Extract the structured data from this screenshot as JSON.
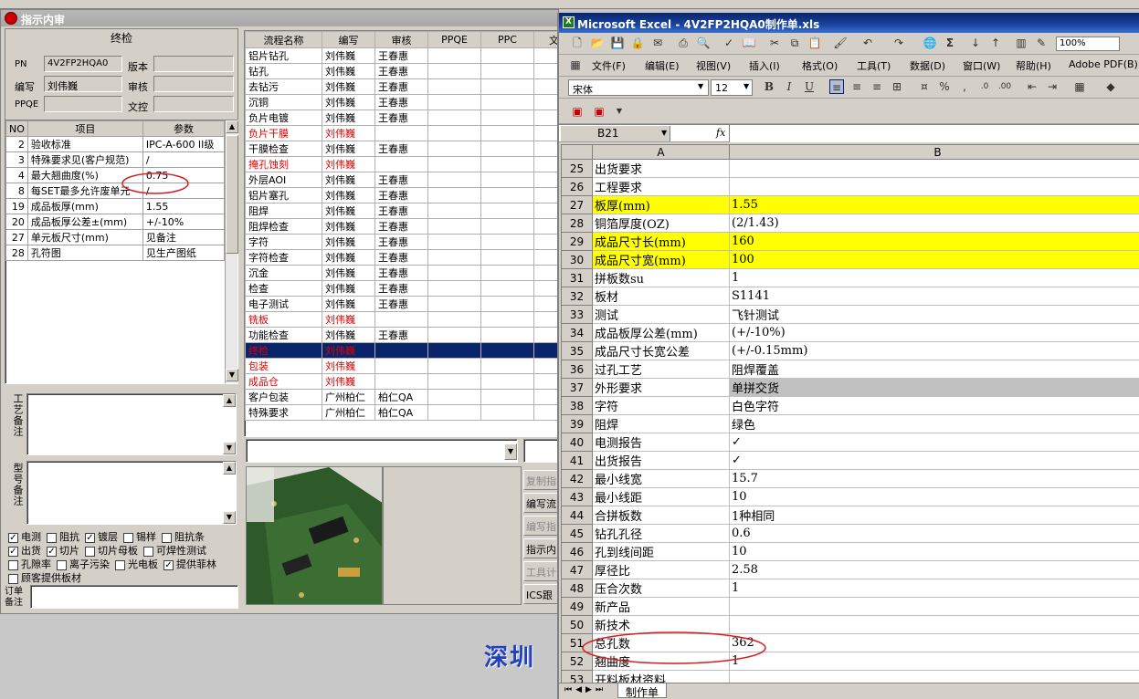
{
  "left_window": {
    "title": "指示内审",
    "section_title": "终检",
    "fields": {
      "pn_label": "PN",
      "pn_value": "4V2FP2HQA0",
      "version_label": "版本",
      "editor_label": "编写",
      "editor_value": "刘伟巍",
      "audit_label": "审核",
      "ppqe_label": "PPQE",
      "control_label": "文控"
    },
    "param_table": {
      "headers": [
        "NO",
        "项目",
        "参数"
      ],
      "rows": [
        [
          "2",
          "验收标准",
          "IPC-A-600 II级"
        ],
        [
          "3",
          "特殊要求见(客户规范)",
          "/"
        ],
        [
          "4",
          "最大翘曲度(%)",
          "0.75"
        ],
        [
          "8",
          "每SET最多允许废单元",
          "/"
        ],
        [
          "19",
          "成品板厚(mm)",
          "1.55"
        ],
        [
          "20",
          "成品板厚公差±(mm)",
          "+/-10%"
        ],
        [
          "27",
          "单元板尺寸(mm)",
          "见备注"
        ],
        [
          "28",
          "孔符图",
          "见生产图纸"
        ]
      ]
    },
    "process_label": "工艺备注",
    "model_label": "型号备注",
    "checkbox_rows": [
      [
        {
          "label": "电测",
          "checked": true
        },
        {
          "label": "阻抗",
          "checked": false
        },
        {
          "label": "镀层",
          "checked": true
        },
        {
          "label": "锡样",
          "checked": false
        },
        {
          "label": "阻抗条",
          "checked": false
        }
      ],
      [
        {
          "label": "出货",
          "checked": true
        },
        {
          "label": "切片",
          "checked": true
        },
        {
          "label": "切片母板",
          "checked": false
        },
        {
          "label": "可焊性测试",
          "checked": false
        }
      ],
      [
        {
          "label": "孔隙率",
          "checked": false
        },
        {
          "label": "离子污染",
          "checked": false
        },
        {
          "label": "光电板",
          "checked": false
        },
        {
          "label": "提供菲林",
          "checked": true
        }
      ],
      [
        {
          "label": "顾客提供板材",
          "checked": false
        }
      ]
    ],
    "order_label": "订单备注",
    "flow_table": {
      "headers": [
        "流程名称",
        "编写",
        "审核",
        "PPQE",
        "PPC",
        "文"
      ],
      "rows": [
        {
          "name": "铝片钻孔",
          "editor": "刘伟巍",
          "auditor": "王春惠",
          "red": false
        },
        {
          "name": "钻孔",
          "editor": "刘伟巍",
          "auditor": "王春惠",
          "red": false
        },
        {
          "name": "去钻污",
          "editor": "刘伟巍",
          "auditor": "王春惠",
          "red": false
        },
        {
          "name": "沉铜",
          "editor": "刘伟巍",
          "auditor": "王春惠",
          "red": false
        },
        {
          "name": "负片电镀",
          "editor": "刘伟巍",
          "auditor": "王春惠",
          "red": false
        },
        {
          "name": "负片干膜",
          "editor": "刘伟巍",
          "auditor": "",
          "red": true
        },
        {
          "name": "干膜检查",
          "editor": "刘伟巍",
          "auditor": "王春惠",
          "red": false
        },
        {
          "name": "掩孔蚀刻",
          "editor": "刘伟巍",
          "auditor": "",
          "red": true
        },
        {
          "name": "外层AOI",
          "editor": "刘伟巍",
          "auditor": "王春惠",
          "red": false
        },
        {
          "name": "铝片塞孔",
          "editor": "刘伟巍",
          "auditor": "王春惠",
          "red": false
        },
        {
          "name": "阻焊",
          "editor": "刘伟巍",
          "auditor": "王春惠",
          "red": false
        },
        {
          "name": "阻焊检查",
          "editor": "刘伟巍",
          "auditor": "王春惠",
          "red": false
        },
        {
          "name": "字符",
          "editor": "刘伟巍",
          "auditor": "王春惠",
          "red": false
        },
        {
          "name": "字符检查",
          "editor": "刘伟巍",
          "auditor": "王春惠",
          "red": false
        },
        {
          "name": "沉金",
          "editor": "刘伟巍",
          "auditor": "王春惠",
          "red": false
        },
        {
          "name": "检查",
          "editor": "刘伟巍",
          "auditor": "王春惠",
          "red": false
        },
        {
          "name": "电子测试",
          "editor": "刘伟巍",
          "auditor": "王春惠",
          "red": false
        },
        {
          "name": "铣板",
          "editor": "刘伟巍",
          "auditor": "",
          "red": true
        },
        {
          "name": "功能检查",
          "editor": "刘伟巍",
          "auditor": "王春惠",
          "red": false
        },
        {
          "name": "终检",
          "editor": "刘伟巍",
          "auditor": "",
          "red": true,
          "selected": true
        },
        {
          "name": "包装",
          "editor": "刘伟巍",
          "auditor": "",
          "red": true
        },
        {
          "name": "成品仓",
          "editor": "刘伟巍",
          "auditor": "",
          "red": true
        },
        {
          "name": "客户包装",
          "editor": "广州柏仁",
          "auditor": "柏仁QA",
          "red": false
        },
        {
          "name": "特殊要求",
          "editor": "广州柏仁",
          "auditor": "柏仁QA",
          "red": false
        }
      ]
    },
    "side_buttons": [
      {
        "label": "复制指",
        "disabled": true
      },
      {
        "label": "编写流",
        "disabled": false
      },
      {
        "label": "编写指",
        "disabled": true
      },
      {
        "label": "指示内",
        "disabled": false
      },
      {
        "label": "工具计",
        "disabled": true
      },
      {
        "label": "ICS跟",
        "disabled": false
      }
    ],
    "watermark": "深圳"
  },
  "excel": {
    "title": "Microsoft Excel - 4V2FP2HQA0制作单.xls",
    "menu": [
      "文件(F)",
      "编辑(E)",
      "视图(V)",
      "插入(I)",
      "格式(O)",
      "工具(T)",
      "数据(D)",
      "窗口(W)",
      "帮助(H)",
      "Adobe PDF(B)"
    ],
    "zoom": "100%",
    "font_name": "宋体",
    "font_size": "12",
    "name_box": "B21",
    "fx": "fx",
    "col_headers": [
      "A",
      "B"
    ],
    "rows": [
      {
        "n": "25",
        "a": "出货要求",
        "b": ""
      },
      {
        "n": "26",
        "a": "工程要求",
        "b": ""
      },
      {
        "n": "27",
        "a": "板厚(mm)",
        "b": "1.55",
        "hl": true
      },
      {
        "n": "28",
        "a": "铜箔厚度(OZ)",
        "b": "(2/1.43)"
      },
      {
        "n": "29",
        "a": "成品尺寸长(mm)",
        "b": "160",
        "hl": true
      },
      {
        "n": "30",
        "a": "成品尺寸宽(mm)",
        "b": "100",
        "hl": true
      },
      {
        "n": "31",
        "a": "拼板数su",
        "b": "1"
      },
      {
        "n": "32",
        "a": "板材",
        "b": "S1141"
      },
      {
        "n": "33",
        "a": "测试",
        "b": "飞针测试"
      },
      {
        "n": "34",
        "a": "成品板厚公差(mm)",
        "b": "(+/-10%)"
      },
      {
        "n": "35",
        "a": "成品尺寸长宽公差",
        "b": "(+/-0.15mm)"
      },
      {
        "n": "36",
        "a": "过孔工艺",
        "b": "阻焊覆盖"
      },
      {
        "n": "37",
        "a": "外形要求",
        "b": "单拼交货",
        "gray": true
      },
      {
        "n": "38",
        "a": "字符",
        "b": "白色字符"
      },
      {
        "n": "39",
        "a": "阻焊",
        "b": "绿色"
      },
      {
        "n": "40",
        "a": "电测报告",
        "b": "✓"
      },
      {
        "n": "41",
        "a": "出货报告",
        "b": "✓"
      },
      {
        "n": "42",
        "a": "最小线宽",
        "b": "15.7"
      },
      {
        "n": "43",
        "a": "最小线距",
        "b": "10"
      },
      {
        "n": "44",
        "a": "合拼板数",
        "b": "1种相同"
      },
      {
        "n": "45",
        "a": "钻孔孔径",
        "b": "0.6"
      },
      {
        "n": "46",
        "a": "孔到线间距",
        "b": "10"
      },
      {
        "n": "47",
        "a": "厚径比",
        "b": "2.58"
      },
      {
        "n": "48",
        "a": "压合次数",
        "b": "1"
      },
      {
        "n": "49",
        "a": "新产品",
        "b": ""
      },
      {
        "n": "50",
        "a": "新技术",
        "b": ""
      },
      {
        "n": "51",
        "a": "总孔数",
        "b": "362"
      },
      {
        "n": "52",
        "a": "翘曲度",
        "b": "1"
      },
      {
        "n": "53",
        "a": "开料板材资料",
        "b": ""
      },
      {
        "n": "54",
        "a": "层",
        "b": "顶铜厚 底铜厚 含铜板厚 不含铜板厚 正公差 负公差"
      }
    ],
    "sheet_tab": "制作单"
  }
}
